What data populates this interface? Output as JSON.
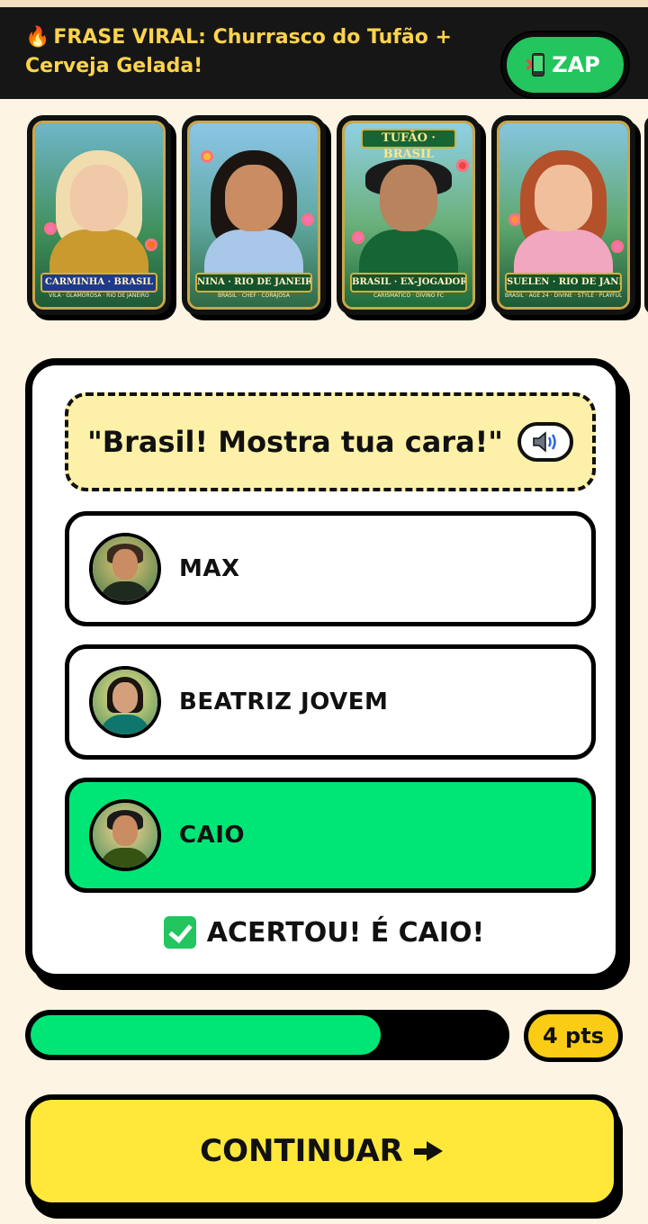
{
  "banner": {
    "text": "FRASE VIRAL: Churrasco do Tufão + Cerveja Gelada!",
    "share_button_label": "ZAP"
  },
  "cards": [
    {
      "name": "CARMINHA · BRASIL",
      "subtitle": "VILÃ · GLAMOROSA · RIO DE JANEIRO",
      "top_title": ""
    },
    {
      "name": "NINA · RIO DE JANEIRO",
      "subtitle": "BRASIL · CHEF · CORAJOSA",
      "top_title": ""
    },
    {
      "name": "BRASIL · EX-JOGADOR",
      "subtitle": "CARISMÁTICO · DIVINO FC",
      "top_title": "TUFÃO · BRASIL"
    },
    {
      "name": "SUELEN · RIO DE JANEIRO",
      "subtitle": "BRASIL · AGE 24 · DIVINE · STYLE · PLAYFUL",
      "top_title": ""
    }
  ],
  "quiz": {
    "quote": "\"Brasil! Mostra tua cara!\"",
    "options": [
      {
        "label": "MAX",
        "state": "default"
      },
      {
        "label": "BEATRIZ JOVEM",
        "state": "default"
      },
      {
        "label": "CAIO",
        "state": "correct"
      }
    ],
    "result_text": "ACERTOU! É CAIO!"
  },
  "progress": {
    "fraction": 0.74
  },
  "score": {
    "label": "4 pts"
  },
  "cta": {
    "label": "CONTINUAR"
  },
  "colors": {
    "accent_green": "#00e676",
    "accent_yellow": "#ffe83a",
    "banner_bg": "#161616",
    "banner_text": "#fcd34d",
    "page_bg": "#fdf4e3"
  }
}
